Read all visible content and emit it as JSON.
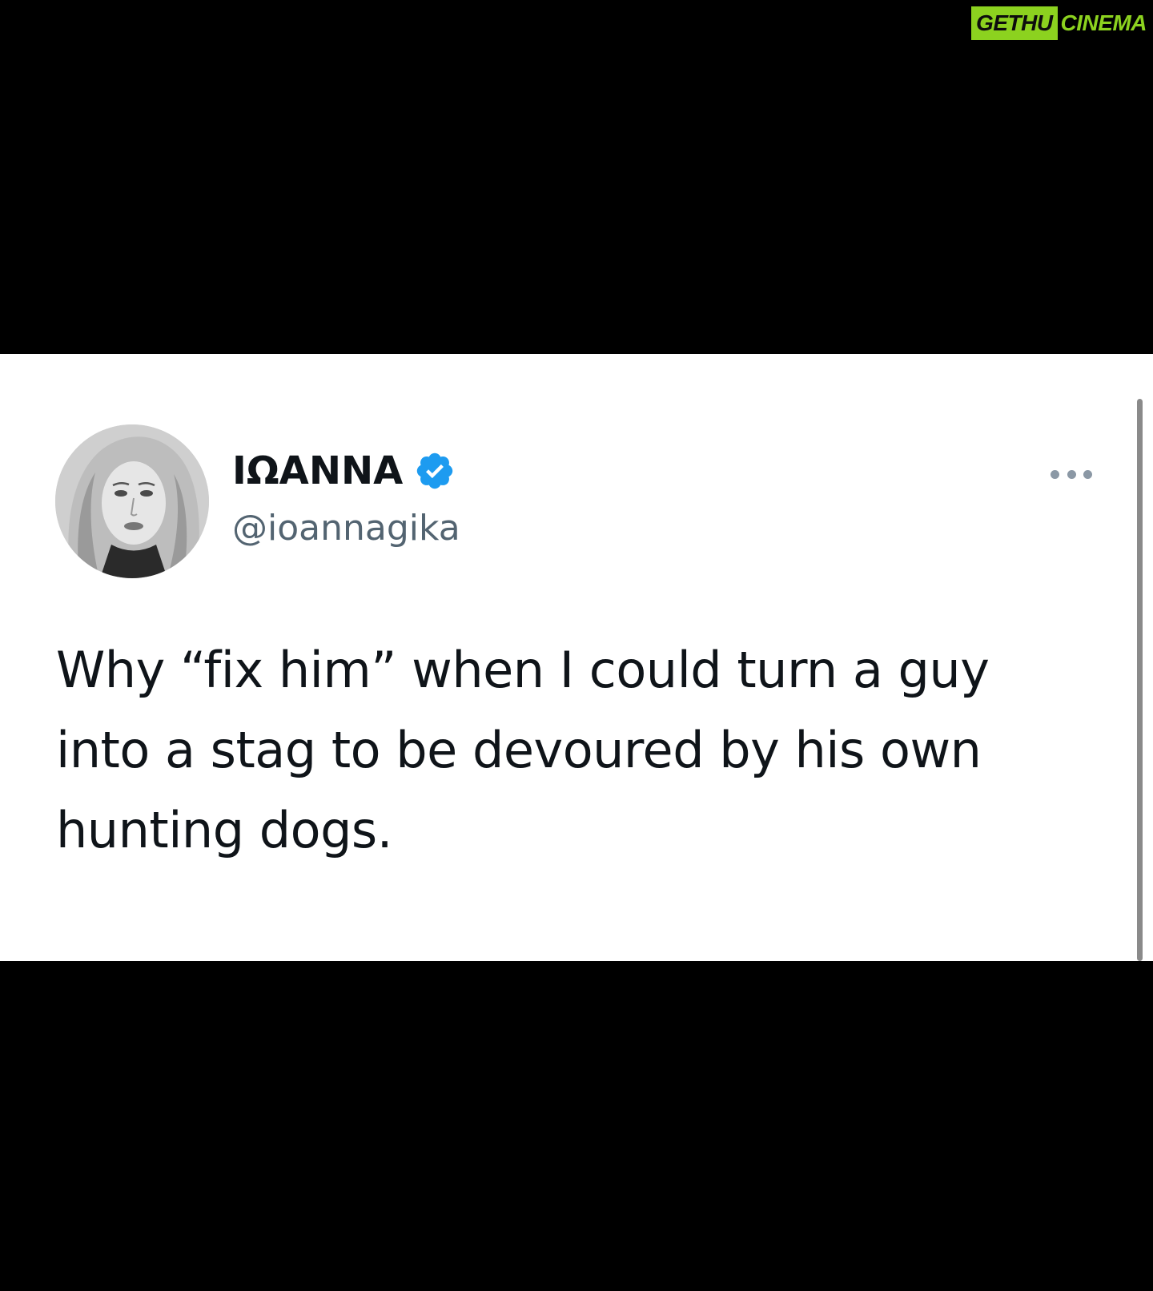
{
  "watermark": {
    "part1": "GETHU",
    "part2": "CINEMA",
    "color": "#8cd21f"
  },
  "tweet": {
    "display_name": "ΙΩΑΝΝΑ",
    "verified": true,
    "verified_color": "#1d9bf0",
    "handle": "@ioannagika",
    "text": "Why “fix him” when I could turn a guy into a stag to be devoured by his own hunting dogs.",
    "avatar_icon": "profile-photo",
    "more_icon": "more-dots-icon"
  }
}
